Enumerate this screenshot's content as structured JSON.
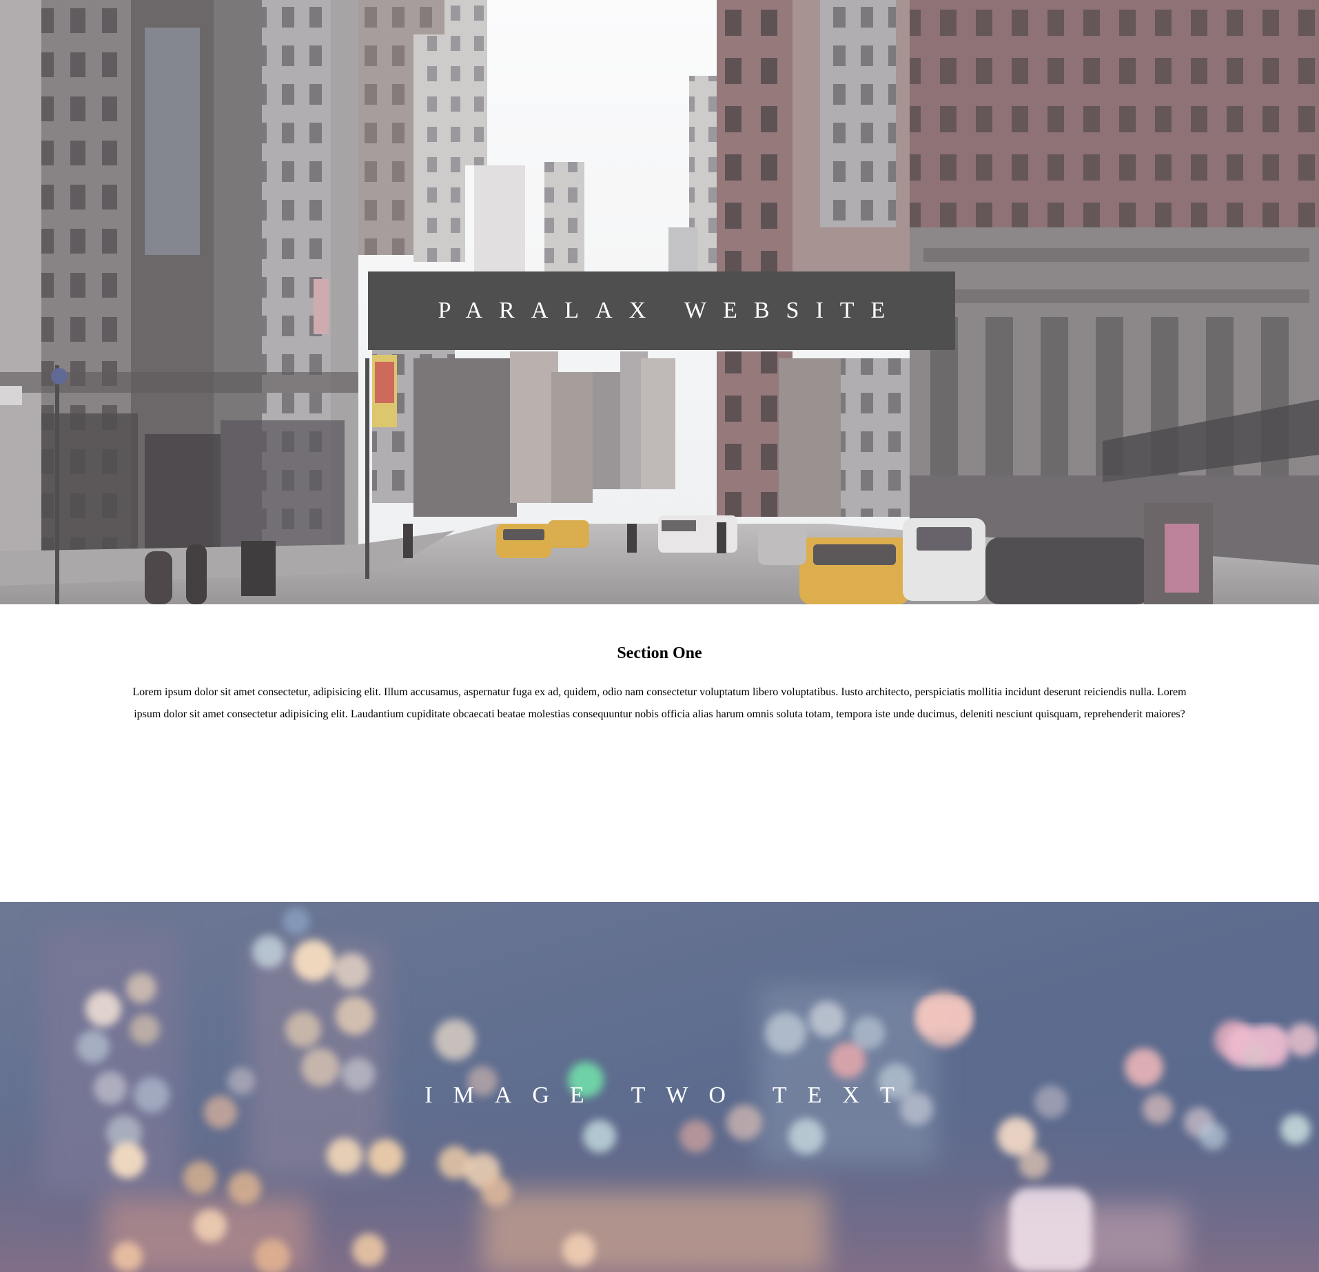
{
  "hero": {
    "title": "PARALAX WEBSITE",
    "background_image": "city-street-photo"
  },
  "section_one": {
    "heading": "Section One",
    "body": "Lorem ipsum dolor sit amet consectetur, adipisicing elit. Illum accusamus, aspernatur fuga ex ad, quidem, odio nam consectetur voluptatum libero voluptatibus. Iusto architecto, perspiciatis mollitia incidunt deserunt reiciendis nulla. Lorem ipsum dolor sit amet consectetur adipisicing elit. Laudantium cupiditate obcaecati beatae molestias consequuntur nobis officia alias harum omnis soluta totam, tempora iste unde ducimus, deleniti nesciunt quisquam, reprehenderit maiores?"
  },
  "image_two": {
    "text": "IMAGE TWO TEXT",
    "background_image": "city-lights-bokeh-photo"
  },
  "colors": {
    "title_box_bg": "#4f4f4f",
    "text_light": "#ffffff",
    "text_dark": "#000000",
    "page_bg": "#ffffff"
  }
}
